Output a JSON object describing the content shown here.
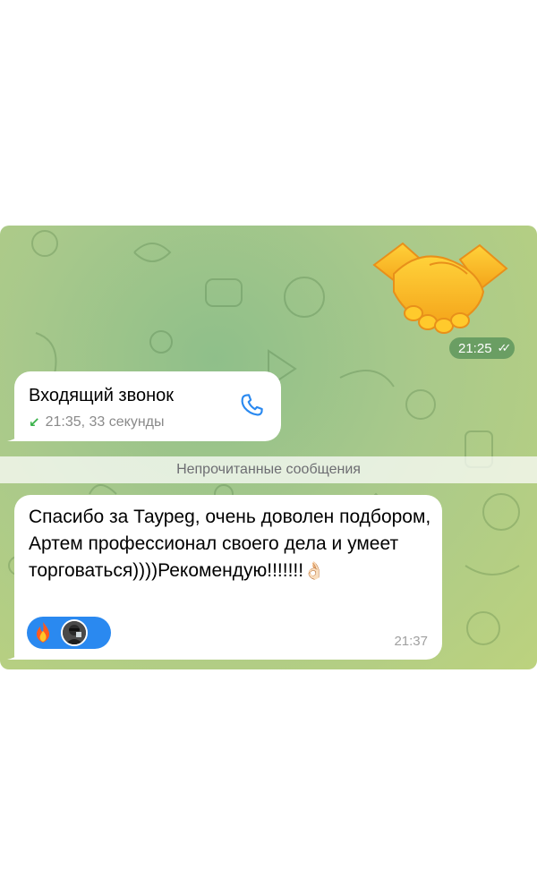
{
  "sticker": {
    "name": "handshake-sticker",
    "time": "21:25",
    "read_status": "double-check"
  },
  "call": {
    "title": "Входящий звонок",
    "direction_icon": "incoming-arrow-icon",
    "meta": "21:35, 33 секунды",
    "action_icon": "phone-icon"
  },
  "unread_label": "Непрочитанные сообщения",
  "message": {
    "text": "Спасибо за Тауреg, очень доволен подбором, Артем профессионал своего дела и умеет торговаться))))Рекомендую!!!!!!!",
    "emoji": "👌🏻",
    "reactions": [
      {
        "icon": "fire-icon"
      },
      {
        "icon": "user-avatar"
      }
    ],
    "time": "21:37"
  },
  "colors": {
    "accent": "#2a89f0",
    "incoming_arrow": "#3ab24a",
    "time_pill": "#6a9e63"
  }
}
